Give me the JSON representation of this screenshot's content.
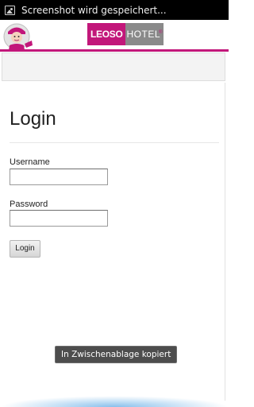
{
  "status_bar": {
    "icon": "image-icon",
    "notification_text": "Screenshot wird gespeichert..."
  },
  "header": {
    "logo_part1": "LEOSO",
    "logo_part2": "HOTEL",
    "logo_reg_mark": "®",
    "brand_color": "#c2177a",
    "logo_gray": "#8a8a8a"
  },
  "login_form": {
    "title": "Login",
    "username_label": "Username",
    "username_value": "",
    "password_label": "Password",
    "password_value": "",
    "submit_label": "Login"
  },
  "toast": {
    "text": "In Zwischenablage kopiert"
  }
}
